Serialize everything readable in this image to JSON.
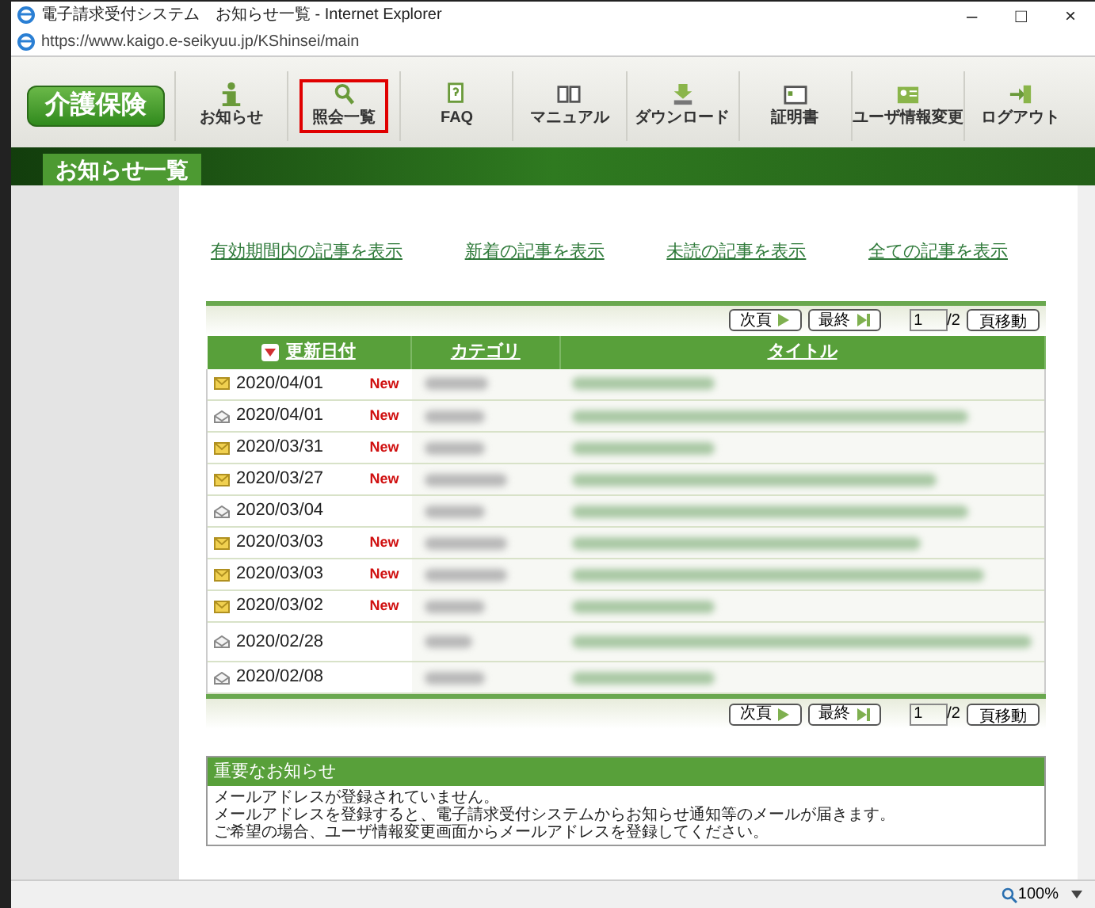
{
  "window": {
    "title": "電子請求受付システム　お知らせ一覧 - Internet Explorer",
    "controls": [
      "–",
      "□",
      "×"
    ]
  },
  "address_bar": {
    "url": "https://www.kaigo.e-seikyuu.jp/KShinsei/main"
  },
  "toolbar": {
    "logo": "介護保険",
    "items": [
      {
        "label": "お知らせ",
        "selected": false
      },
      {
        "label": "照会一覧",
        "selected": true
      },
      {
        "label": "FAQ",
        "selected": false
      },
      {
        "label": "マニュアル",
        "selected": false
      },
      {
        "label": "ダウンロード",
        "selected": false
      },
      {
        "label": "証明書",
        "selected": false
      },
      {
        "label": "ユーザ情報変更",
        "selected": false
      },
      {
        "label": "ログアウト",
        "selected": false
      }
    ]
  },
  "page_title": "お知らせ一覧",
  "filter_links": [
    "有効期間内の記事を表示",
    "新着の記事を表示",
    "未読の記事を表示",
    "全ての記事を表示"
  ],
  "pager_top": {
    "next": "次頁",
    "last": "最終",
    "page": "1",
    "total": "/2",
    "go": "頁移動"
  },
  "table": {
    "columns": [
      "更新日付",
      "カテゴリ",
      "タイトル"
    ],
    "rows": [
      {
        "date": "2020/04/01",
        "unread": true,
        "badge": "New"
      },
      {
        "date": "2020/04/01",
        "unread": false,
        "badge": "New"
      },
      {
        "date": "2020/03/31",
        "unread": true,
        "badge": "New"
      },
      {
        "date": "2020/03/27",
        "unread": true,
        "badge": "New"
      },
      {
        "date": "2020/03/04",
        "unread": false
      },
      {
        "date": "2020/03/03",
        "unread": true,
        "badge": "New"
      },
      {
        "date": "2020/03/03",
        "unread": true,
        "badge": "New"
      },
      {
        "date": "2020/03/02",
        "unread": true,
        "badge": "New"
      },
      {
        "date": "2020/02/28",
        "unread": false
      },
      {
        "date": "2020/02/08",
        "unread": false
      }
    ]
  },
  "pager_bottom": {
    "next": "次頁",
    "last": "最終",
    "page": "1",
    "total": "/2",
    "go": "頁移動"
  },
  "notice": {
    "title": "重要なお知らせ",
    "lines": [
      "メールアドレスが登録されていません。",
      "メールアドレスを登録すると、電子請求受付システムからお知らせ通知等のメールが届きます。",
      "ご希望の場合、ユーザ情報変更画面からメールアドレスを登録してください。"
    ]
  },
  "status_bar": {
    "zoom": "100%"
  }
}
